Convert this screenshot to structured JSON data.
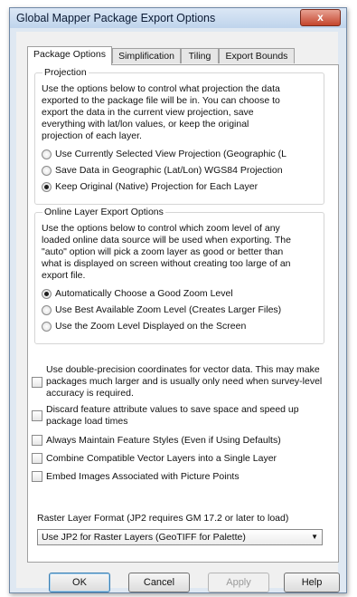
{
  "window": {
    "title": "Global Mapper Package Export Options",
    "close_label": "x"
  },
  "tabs": [
    {
      "label": "Package Options",
      "active": true
    },
    {
      "label": "Simplification",
      "active": false
    },
    {
      "label": "Tiling",
      "active": false
    },
    {
      "label": "Export Bounds",
      "active": false
    }
  ],
  "projection": {
    "legend": "Projection",
    "description": [
      "Use the options below to control what projection the data",
      "exported to the package file will be in. You can choose to",
      "export the data in the current view projection, save",
      "everything with lat/lon values, or keep the original",
      "projection of each layer."
    ],
    "options": [
      {
        "label": "Use Currently Selected View Projection (Geographic (L",
        "selected": false
      },
      {
        "label": "Save Data in Geographic (Lat/Lon) WGS84 Projection",
        "selected": false
      },
      {
        "label": "Keep Original (Native) Projection for Each Layer",
        "selected": true
      }
    ]
  },
  "online": {
    "legend": "Online Layer Export Options",
    "description": [
      "Use the options below to control which zoom level of any",
      "loaded online data source will be used when exporting. The",
      "\"auto\" option will pick a zoom layer as good or better than",
      "what is displayed on screen without creating too large of an",
      "export file."
    ],
    "options": [
      {
        "label": "Automatically Choose a Good Zoom Level",
        "selected": true
      },
      {
        "label": "Use Best Available Zoom Level (Creates Larger Files)",
        "selected": false
      },
      {
        "label": "Use the Zoom Level Displayed on the Screen",
        "selected": false
      }
    ]
  },
  "checkboxes": [
    {
      "label": "Use double-precision coordinates for vector data. This may make packages much larger and is usually only need when survey-level accuracy is required.",
      "checked": false
    },
    {
      "label": "Discard feature attribute values to save space and speed up package load times",
      "checked": false
    },
    {
      "label": "Always Maintain Feature Styles (Even if Using Defaults)",
      "checked": false
    },
    {
      "label": "Combine Compatible Vector Layers into a Single Layer",
      "checked": false
    },
    {
      "label": "Embed Images Associated with Picture Points",
      "checked": false
    }
  ],
  "raster": {
    "label": "Raster Layer Format (JP2 requires GM 17.2 or later to load)",
    "selected": "Use JP2 for Raster Layers (GeoTIFF for Palette)"
  },
  "buttons": {
    "ok": "OK",
    "cancel": "Cancel",
    "apply": "Apply",
    "help": "Help"
  },
  "colors": {
    "title_bar": "#c9dbef",
    "close_button": "#c9503a",
    "dialog_bg": "#f0f0f0",
    "panel_bg": "#ffffff"
  }
}
